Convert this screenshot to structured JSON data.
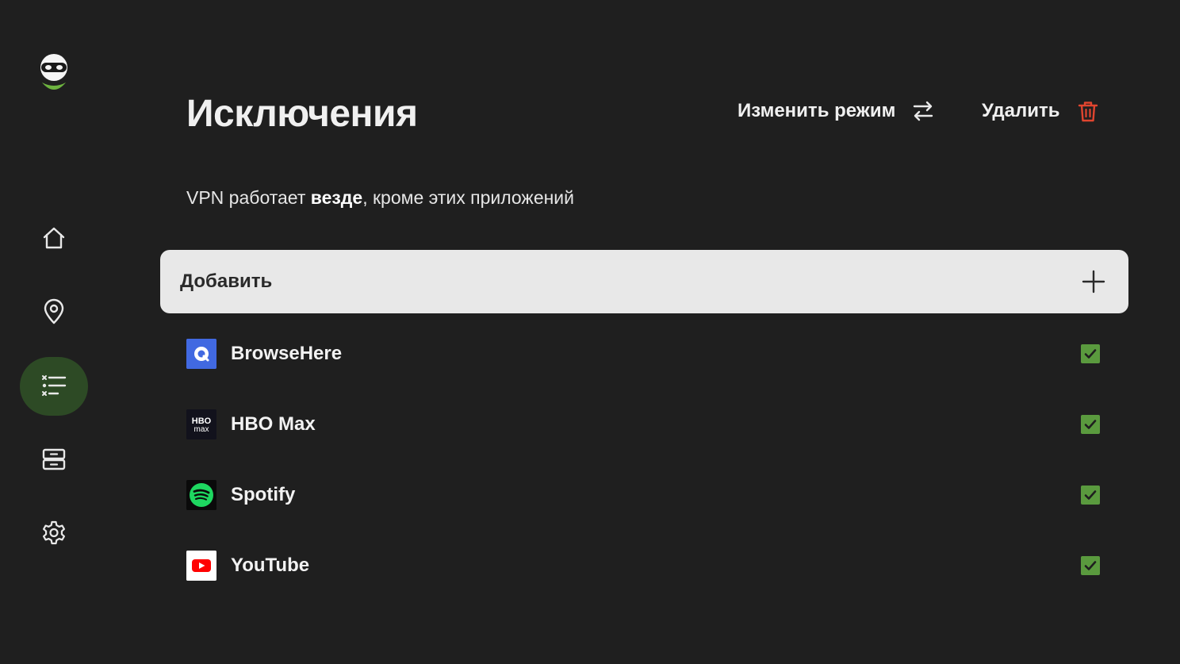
{
  "header": {
    "title": "Исключения",
    "change_mode_label": "Изменить режим",
    "delete_label": "Удалить"
  },
  "subtitle": {
    "prefix": "VPN работает ",
    "emphasis": "везде",
    "suffix": ", кроме этих приложений"
  },
  "add_bar": {
    "label": "Добавить"
  },
  "sidebar": {
    "items": [
      {
        "name": "home",
        "icon": "home-icon",
        "active": false
      },
      {
        "name": "locations",
        "icon": "location-pin-icon",
        "active": false
      },
      {
        "name": "exclusions",
        "icon": "checklist-icon",
        "active": true
      },
      {
        "name": "servers",
        "icon": "server-icon",
        "active": false
      },
      {
        "name": "settings",
        "icon": "gear-icon",
        "active": false
      }
    ]
  },
  "apps": [
    {
      "name": "BrowseHere",
      "icon": "browsehere-icon",
      "checked": true
    },
    {
      "name": "HBO Max",
      "icon": "hbo-max-icon",
      "checked": true
    },
    {
      "name": "Spotify",
      "icon": "spotify-icon",
      "checked": true
    },
    {
      "name": "YouTube",
      "icon": "youtube-icon",
      "checked": true
    }
  ],
  "colors": {
    "background": "#1f1f1f",
    "active_nav": "#2d4a25",
    "checkbox": "#5a9a3e",
    "delete_icon": "#e0452f",
    "add_bar": "#e8e8e8"
  }
}
